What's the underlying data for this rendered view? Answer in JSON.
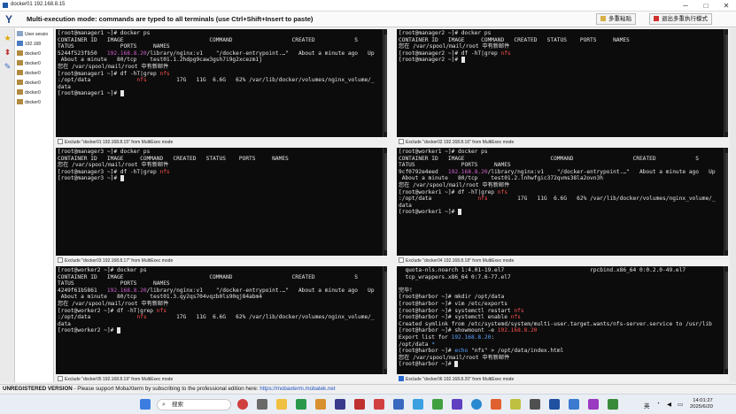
{
  "window": {
    "title": "docker01 192.168.8.15",
    "minimize": "─",
    "maximize": "□",
    "close": "✕"
  },
  "header": {
    "logo": "Y",
    "message": "Multi-execution mode: commands are typed to all terminals (use Ctrl+Shift+Insert to paste)",
    "paste_button": "多重粘贴",
    "exit_button": "退出多重执行模式"
  },
  "sidebar": {
    "icons": [
      "star-icon",
      "pin-icon",
      "edit-icon"
    ]
  },
  "sessions": {
    "root_label": "User sessio",
    "items": [
      {
        "label": "192.168"
      },
      {
        "label": "docker0"
      },
      {
        "label": "docker0"
      },
      {
        "label": "docker0"
      },
      {
        "label": "docker0"
      },
      {
        "label": "docker0"
      },
      {
        "label": "docker0"
      }
    ]
  },
  "terminals": [
    {
      "exclude_label": "Exclude \"docker01 192.168.8.15\" from MultiExec mode",
      "checked": false,
      "lines": [
        "[root@manager1 ~]# docker ps",
        "CONTAINER ID   IMAGE                          COMMAND                  CREATED            S",
        "TATUS              PORTS     NAMES",
        "5244f523fb50   192.168.8.20/library/nginx:v1    \"/docker-entrypoint.…\"   About a minute ago   Up",
        " About a minute   80/tcp    test01.1.2hdpg9caw3gsh7i9g2xcezm1j",
        "您在 /var/spool/mail/root 中有新邮件",
        "[root@manager1 ~]# df -hT|grep nfs",
        ":/opt/data              nfs         17G   11G  6.6G   62% /var/lib/docker/volumes/nginx_volume/_",
        "data",
        "[root@manager1 ~]# "
      ]
    },
    {
      "exclude_label": "Exclude \"docker02 192.168.8.16\" from MultiExec mode",
      "checked": false,
      "lines": [
        "[root@manager2 ~]# docker ps",
        "CONTAINER ID   IMAGE     COMMAND   CREATED   STATUS    PORTS     NAMES",
        "您在 /var/spool/mail/root 中有新邮件",
        "[root@manager2 ~]# df -hT|grep nfs",
        "[root@manager2 ~]# "
      ]
    },
    {
      "exclude_label": "Exclude \"docker03 192.168.8.17\" from MultiExec mode",
      "checked": false,
      "lines": [
        "[root@manager3 ~]# docker ps",
        "CONTAINER ID   IMAGE     COMMAND   CREATED   STATUS    PORTS     NAMES",
        "您在 /var/spool/mail/root 中有新邮件",
        "[root@manager3 ~]# df -hT|grep nfs",
        "[root@manager3 ~]# "
      ]
    },
    {
      "exclude_label": "Exclude \"docker04 192.168.8.18\" from MultiExec mode",
      "checked": false,
      "lines": [
        "[root@worker1 ~]# docker ps",
        "CONTAINER ID   IMAGE                          COMMAND                  CREATED            S",
        "TATUS              PORTS     NAMES",
        "9cf0792e4eed   192.168.8.20/library/nginx:v1    \"/docker-entrypoint.…\"   About a minute ago   Up",
        " About a minute   80/tcp    test01.2.lnhwfgic372qvms38la2ovn3h",
        "您在 /var/spool/mail/root 中有新邮件",
        "[root@worker1 ~]# df -hT|grep nfs",
        ":/opt/data              nfs         17G   11G  6.6G   62% /var/lib/docker/volumes/nginx_volume/_",
        "data",
        "[root@worker1 ~]# "
      ]
    },
    {
      "exclude_label": "Exclude \"docker05 192.168.8.19\" from MultiExec mode",
      "checked": false,
      "lines": [
        "[root@worker2 ~]# docker ps",
        "CONTAINER ID   IMAGE                          COMMAND                  CREATED            S",
        "TATUS              PORTS     NAMES",
        "4249f61b5861   192.168.8.20/library/nginx:v1    \"/docker-entrypoint.…\"   About a minute ago   Up",
        " About a minute   80/tcp    test01.3.qy2qs704vqzb0ls90qj84abm4",
        "您在 /var/spool/mail/root 中有新邮件",
        "[root@worker2 ~]# df -hT|grep nfs",
        ":/opt/data              nfs         17G   11G  6.6G   62% /var/lib/docker/volumes/nginx_volume/_",
        "data",
        "[root@worker2 ~]# "
      ]
    },
    {
      "exclude_label": "Exclude \"docker06 192.168.8.20\" from MultiExec mode",
      "checked": true,
      "lines": [
        "  quota-nls.noarch 1:4.01-19.el7                          rpcbind.x86_64 0:0.2.0-49.el7",
        "  tcp_wrappers.x86_64 0:7.6-77.el7",
        "",
        "完毕！",
        "[root@harbor ~]# mkdir /opt/data",
        "[root@harbor ~]# vim /etc/exports",
        "[root@harbor ~]# systemctl restart nfs",
        "[root@harbor ~]# systemctl enable nfs",
        "Created symlink from /etc/systemd/system/multi-user.target.wants/nfs-server.service to /usr/lib",
        "[root@harbor ~]# showmount -e 192.168.8.20",
        "Export list for 192.168.8.20:",
        "/opt/data *",
        "[root@harbor ~]# echo \"nfs\" > /opt/data/index.html",
        "您在 /var/spool/mail/root 中有新邮件",
        "[root@harbor ~]# "
      ]
    }
  ],
  "status": {
    "bold": "UNREGISTERED VERSION",
    "text": "  -  Please support MobaXterm by subscribing to the professional edition here:  ",
    "link": "https://mobaxterm.mobatek.net"
  },
  "taskbar": {
    "search_placeholder": "搜索",
    "lang": "英",
    "time": "14:01:27",
    "date": "2025/6/20"
  },
  "colors": {
    "ip": "#d060d0",
    "nfs": "#ff5050",
    "link_ip": "#5aa0ff"
  }
}
